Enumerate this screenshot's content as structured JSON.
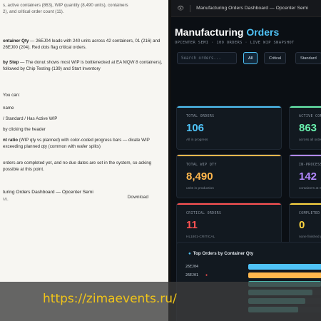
{
  "doc": {
    "top_line": "s, active containers (863), WIP quantity (8,490 units), containers\n2), and critical order count (11).",
    "para1_bold": "ontainer Qty",
    "para1_rest": " — 26EJ04 leads with 240 units across 42 containers, 01 (216) and 26EJ00 (204). Red dots flag critical orders.",
    "para2_bold": "by Step",
    "para2_rest": " — The donut shows most WIP is bottlenecked at EA MQW 8 containers), followed by Chip Testing (139) and Start Inventory",
    "you_can": "You can:",
    "list": [
      "name",
      "/ Standard / Has Active WIP",
      "by clicking the header",
      "nt ratio (WIP qty vs planned) with color-coded progress bars — dicate WIP exceeding planned qty (common with wafer splits)"
    ],
    "list_bold_index": 3,
    "list_bold_text": "nt ratio",
    "note": "orders are completed yet, and no due dates are set in the system, so acking possible at this point.",
    "attachment_title": "turing Orders Dashboard — Opcenter Semi",
    "attachment_sub": "ML",
    "download_label": "Download"
  },
  "browser": {
    "eye_icon": "eye-icon",
    "tab_title": "Manufacturing Orders Dashboard — Opcenter Semi"
  },
  "dashboard": {
    "title_main": "Manufacturing ",
    "title_accent": "Orders",
    "subtitle": "OPCENTER SEMI · 109 ORDERS · LIVE WIP SNAPSHOT",
    "search_placeholder": "Search orders...",
    "filters": [
      "All",
      "Critical",
      "Standard"
    ],
    "active_filter": "All",
    "cards": [
      {
        "label": "TOTAL ORDERS",
        "value": "106",
        "desc": "All in progress",
        "color": "#4fc3f7"
      },
      {
        "label": "ACTIVE CONTAINERS",
        "value": "863",
        "desc": "across all orders",
        "color": "#69f0ae"
      },
      {
        "label": "TOTAL WIP QTY",
        "value": "8,490",
        "desc": "units in production",
        "color": "#ffb74d"
      },
      {
        "label": "IN-PROCESS CONTAINERS",
        "value": "142",
        "desc": "containers at Steps",
        "color": "#b388ff"
      },
      {
        "label": "CRITICAL ORDERS",
        "value": "11",
        "desc": "HL1801-CRITICAL",
        "color": "#ff5252"
      },
      {
        "label": "COMPLETED ORDERS",
        "value": "0",
        "desc": "none finished yet",
        "color": "#ffd740"
      }
    ],
    "panel_title": "Top Orders by Container Qty",
    "rows": [
      {
        "name": "26EJ04",
        "critical": false,
        "value": 240,
        "color": "#4fc3f7"
      },
      {
        "name": "26EJ01",
        "critical": true,
        "value": 216,
        "color": "#ffb74d"
      },
      {
        "name": "",
        "critical": false,
        "value": 204,
        "color": "#4db6ac"
      },
      {
        "name": "",
        "critical": false,
        "value": 180,
        "color": "#4db6ac"
      },
      {
        "name": "",
        "critical": false,
        "value": 160,
        "color": "#4db6ac"
      },
      {
        "name": "",
        "critical": false,
        "value": 140,
        "color": "#4db6ac"
      }
    ],
    "row_max": 240
  },
  "watermark": "https://zimaevents.ru/"
}
